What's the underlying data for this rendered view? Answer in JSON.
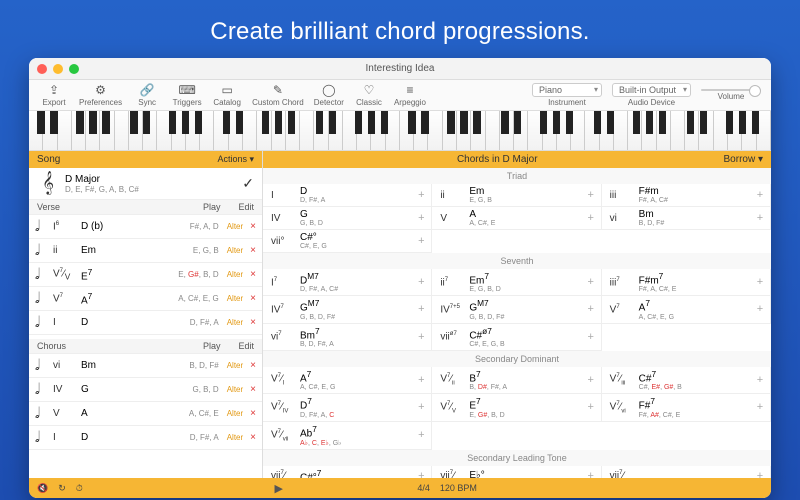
{
  "hero": "Create brilliant chord progressions.",
  "title": "Interesting Idea",
  "toolbar_items": [
    "Export",
    "Preferences",
    "Sync",
    "Triggers",
    "Catalog",
    "Custom Chord",
    "Detector",
    "Classic",
    "Arpeggio"
  ],
  "instrument": {
    "value": "Piano",
    "label": "Instrument"
  },
  "audio_device": {
    "value": "Built-in Output",
    "label": "Audio Device"
  },
  "volume_label": "Volume",
  "song_panel": {
    "title": "Song",
    "actions": "Actions ▾"
  },
  "key": {
    "name": "D Major",
    "notes": "D, E, F#, G, A, B, C#"
  },
  "verse": {
    "label": "Verse",
    "play": "Play",
    "edit": "Edit"
  },
  "chorus": {
    "label": "Chorus",
    "play": "Play",
    "edit": "Edit"
  },
  "alter": "Alter",
  "x": "×",
  "verse_rows": [
    {
      "rn": "I<sup>6</sup>",
      "ch": "D (b)",
      "t": "F#, A, D"
    },
    {
      "rn": "ii",
      "ch": "Em",
      "t": "E, G, B"
    },
    {
      "rn": "V<sup>7</sup>⁄<sub>V</sub>",
      "ch": "E<sup>7</sup>",
      "t": "E, <span class='r'>G#</span>, B, D"
    },
    {
      "rn": "V<sup>7</sup>",
      "ch": "A<sup>7</sup>",
      "t": "A, C#, E, G"
    },
    {
      "rn": "I",
      "ch": "D",
      "t": "D, F#, A"
    }
  ],
  "chorus_rows": [
    {
      "rn": "vi",
      "ch": "Bm",
      "t": "B, D, F#"
    },
    {
      "rn": "IV",
      "ch": "G",
      "t": "G, B, D"
    },
    {
      "rn": "V",
      "ch": "A",
      "t": "A, C#, E"
    },
    {
      "rn": "I",
      "ch": "D",
      "t": "D, F#, A"
    }
  ],
  "chords_panel": {
    "title": "Chords in D Major",
    "borrow": "Borrow ▾"
  },
  "groups": {
    "triad": "Triad",
    "seventh": "Seventh",
    "sec_dom": "Secondary Dominant",
    "sec_lead": "Secondary Leading Tone"
  },
  "triad": [
    {
      "d": "I",
      "n": "D",
      "t": "D, F#, A"
    },
    {
      "d": "ii",
      "n": "Em",
      "t": "E, G, B"
    },
    {
      "d": "iii",
      "n": "F#m",
      "t": "F#, A, C#"
    },
    {
      "d": "IV",
      "n": "G",
      "t": "G, B, D"
    },
    {
      "d": "V",
      "n": "A",
      "t": "A, C#, E"
    },
    {
      "d": "vi",
      "n": "Bm",
      "t": "B, D, F#"
    },
    {
      "d": "vii°",
      "n": "C#°",
      "t": "C#, E, G"
    }
  ],
  "seventh": [
    {
      "d": "I<sup>7</sup>",
      "n": "D<sup>M7</sup>",
      "t": "D, F#, A, C#"
    },
    {
      "d": "ii<sup>7</sup>",
      "n": "Em<sup>7</sup>",
      "t": "E, G, B, D"
    },
    {
      "d": "iii<sup>7</sup>",
      "n": "F#m<sup>7</sup>",
      "t": "F#, A, C#, E"
    },
    {
      "d": "IV<sup>7</sup>",
      "n": "G<sup>M7</sup>",
      "t": "G, B, D, F#"
    },
    {
      "d": "IV<sup>7+5</sup>",
      "n": "G<sup>M7</sup>",
      "t": "G, B, D, F#"
    },
    {
      "d": "V<sup>7</sup>",
      "n": "A<sup>7</sup>",
      "t": "A, C#, E, G"
    },
    {
      "d": "vi<sup>7</sup>",
      "n": "Bm<sup>7</sup>",
      "t": "B, D, F#, A"
    },
    {
      "d": "vii<sup>ø7</sup>",
      "n": "C#<sup>ø7</sup>",
      "t": "C#, E, G, B"
    }
  ],
  "sec_dom": [
    {
      "d": "V<sup>7</sup>⁄<sub>I</sub>",
      "n": "A<sup>7</sup>",
      "t": "A, C#, E, G"
    },
    {
      "d": "V<sup>7</sup>⁄<sub>ii</sub>",
      "n": "B<sup>7</sup>",
      "t": "B, <span class='r'>D#</span>, F#, A"
    },
    {
      "d": "V<sup>7</sup>⁄<sub>iii</sub>",
      "n": "C#<sup>7</sup>",
      "t": "C#, <span class='r'>E#</span>, <span class='r'>G#</span>, B"
    },
    {
      "d": "V<sup>7</sup>⁄<sub>IV</sub>",
      "n": "D<sup>7</sup>",
      "t": "D, F#, A, <span class='r'>C</span>"
    },
    {
      "d": "V<sup>7</sup>⁄<sub>V</sub>",
      "n": "E<sup>7</sup>",
      "t": "E, <span class='r'>G#</span>, B, D"
    },
    {
      "d": "V<sup>7</sup>⁄<sub>vi</sub>",
      "n": "F#<sup>7</sup>",
      "t": "F#, <span class='r'>A#</span>, C#, E"
    },
    {
      "d": "V<sup>7</sup>⁄<sub>vii</sub>",
      "n": "Ab<sup>7</sup>",
      "t": "<span class='r'>A♭</span>, <span class='r'>C</span>, <span class='r'>E♭</span>, G♭"
    }
  ],
  "sec_lead": [
    {
      "d": "vii<sup>7</sup>⁄",
      "n": "C#°<sup>7</sup>",
      "t": ""
    },
    {
      "d": "vii<sup>7</sup>⁄",
      "n": "E♭°",
      "t": ""
    },
    {
      "d": "vii<sup>7</sup>⁄",
      "n": "",
      "t": ""
    }
  ],
  "footer": {
    "time": "4/4",
    "tempo": "120 BPM"
  }
}
